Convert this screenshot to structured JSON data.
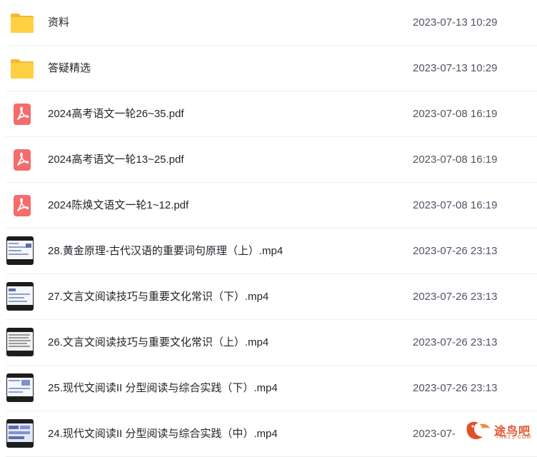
{
  "files": [
    {
      "type": "folder",
      "name": "资料",
      "date": "2023-07-13 10:29"
    },
    {
      "type": "folder",
      "name": "答疑精选",
      "date": "2023-07-13 10:29"
    },
    {
      "type": "pdf",
      "name": "2024高考语文一轮26~35.pdf",
      "date": "2023-07-08 16:19"
    },
    {
      "type": "pdf",
      "name": "2024高考语文一轮13~25.pdf",
      "date": "2023-07-08 16:19"
    },
    {
      "type": "pdf",
      "name": "2024陈焕文语文一轮1~12.pdf",
      "date": "2023-07-08 16:19"
    },
    {
      "type": "video",
      "name": "28.黄金原理-古代汉语的重要词句原理（上）.mp4",
      "date": "2023-07-26 23:13"
    },
    {
      "type": "video",
      "name": "27.文言文阅读技巧与重要文化常识（下）.mp4",
      "date": "2023-07-26 23:13"
    },
    {
      "type": "video",
      "name": "26.文言文阅读技巧与重要文化常识（上）.mp4",
      "date": "2023-07-26 23:13"
    },
    {
      "type": "video",
      "name": "25.现代文阅读II 分型阅读与综合实践（下）.mp4",
      "date": "2023-07-26 23:13"
    },
    {
      "type": "video",
      "name": "24.现代文阅读II 分型阅读与综合实践（中）.mp4",
      "date": "2023-07-"
    }
  ],
  "watermark": {
    "text": "途鸟吧",
    "sub": "TNBZS.COM"
  },
  "colors": {
    "folder": "#ffc93a",
    "pdf": "#f66b6b",
    "border": "#eceef1",
    "date": "#4e5562",
    "watermark": "#e2502b"
  }
}
